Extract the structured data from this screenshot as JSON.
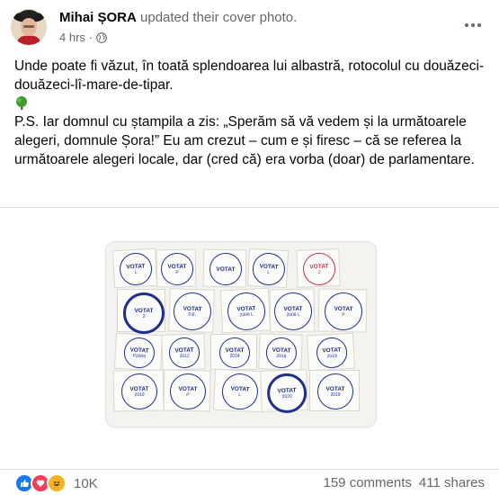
{
  "post": {
    "author": "Mihai ȘORA",
    "action": "updated their cover photo.",
    "time": "4 hrs",
    "paragraphs": [
      "Unde poate fi văzut, în toată splendoarea lui albastră, rotocolul cu douăzeci-douăzeci-lî-mare-de-tipar.",
      "P.S. Iar domnul cu ștampila a zis: „Sperăm să vă vedem și la următoarele alegeri, domnule Șora!” Eu am crezut – cum e și firesc – că se referea la următoarele alegeri locale, dar (cred că) era vorba (doar) de parlamentare."
    ]
  },
  "stamps": [
    {
      "t1": "VOTAT",
      "t2": "L"
    },
    {
      "t1": "VOTAT",
      "t2": "P"
    },
    {
      "t1": "VOTAT",
      "t2": ""
    },
    {
      "t1": "VOTAT",
      "t2": "L"
    },
    {
      "t1": "VOTAT",
      "t2": "2"
    },
    {
      "t1": "VOTAT",
      "t2": "2"
    },
    {
      "t1": "VOTAT",
      "t2": "P.E."
    },
    {
      "t1": "VOTAT",
      "t2": "2008 L"
    },
    {
      "t1": "VOTAT",
      "t2": "2008 L"
    },
    {
      "t1": "VOTAT",
      "t2": "P"
    },
    {
      "t1": "VOTAT",
      "t2": "P2009"
    },
    {
      "t1": "VOTAT",
      "t2": "2012"
    },
    {
      "t1": "VOTAT",
      "t2": "2014"
    },
    {
      "t1": "VOTAT",
      "t2": "2016"
    },
    {
      "t1": "VOTAT",
      "t2": "2019"
    },
    {
      "t1": "VOTAT",
      "t2": "2019"
    },
    {
      "t1": "VOTAT",
      "t2": "P"
    },
    {
      "t1": "VOTAT",
      "t2": "L"
    },
    {
      "t1": "VOTAT",
      "t2": "2020"
    },
    {
      "t1": "VOTAT",
      "t2": "2019"
    }
  ],
  "footer": {
    "reaction_count": "10K",
    "comments": "159 comments",
    "shares": "411 shares"
  },
  "colors": {
    "text": "#050505",
    "secondary": "#65676b",
    "like_blue": "#1877f2",
    "love_red": "#f33e58",
    "haha_yellow": "#f7b125",
    "stamp_blue": "#1f2f8a"
  }
}
